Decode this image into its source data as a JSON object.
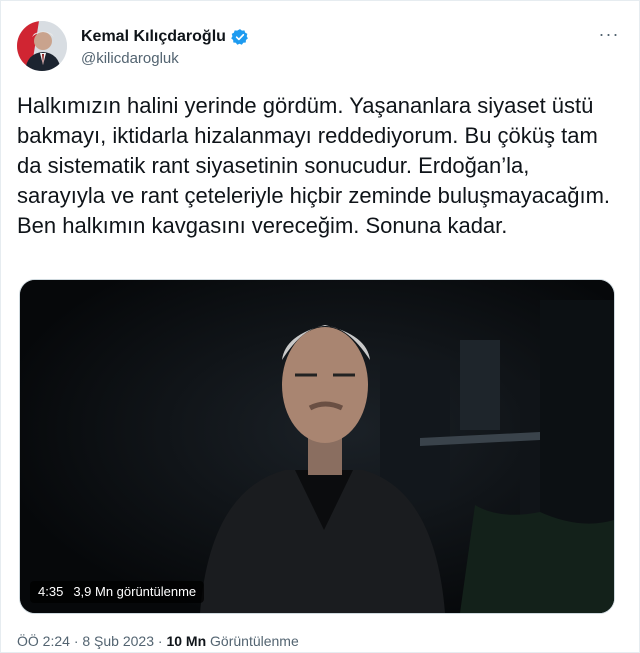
{
  "author": {
    "display_name": "Kemal Kılıçdaroğlu",
    "handle": "@kilicdarogluk",
    "verified_icon": "verified-badge-icon",
    "avatar_icon": "avatar-photo"
  },
  "more_label": "···",
  "tweet": {
    "text": "Halkımızın halini yerinde gördüm. Yaşananlara siyaset üstü bakmayı, iktidarla hizalanmayı reddediyorum. Bu çöküş tam da sistematik rant siyasetinin sonucudur. Erdoğan’la, sarayıyla ve rant çeteleriyle hiçbir zeminde buluşmayacağım. Ben halkımın kavgasını vereceğim. Sonuna kadar."
  },
  "video": {
    "duration": "4:35",
    "views": "3,9 Mn görüntülenme"
  },
  "footer": {
    "time": "ÖÖ 2:24",
    "sep1": "·",
    "date": "8 Şub 2023",
    "sep2": "·",
    "views_count": "10 Mn",
    "views_label": "Görüntülenme"
  },
  "colors": {
    "verified": "#1d9bf0",
    "secondary_text": "#536471",
    "video_bg": "#0a0d0f"
  }
}
